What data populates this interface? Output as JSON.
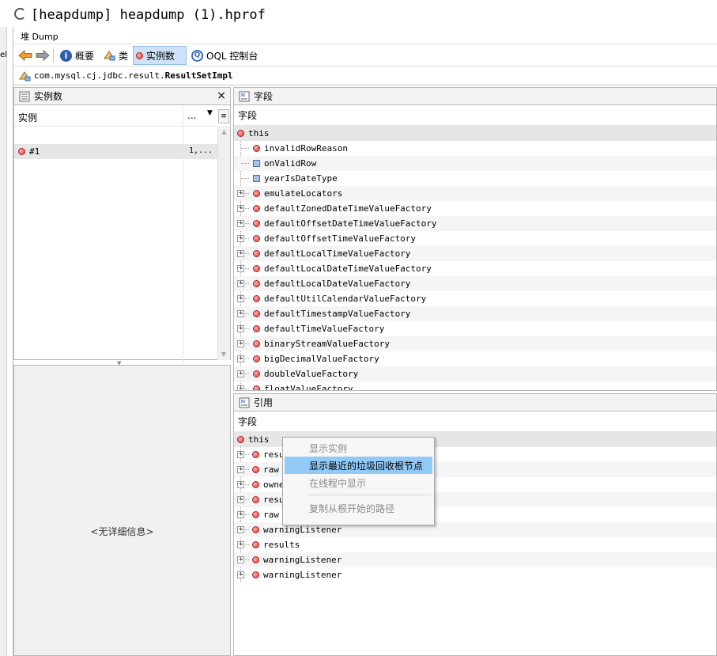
{
  "window": {
    "title": "[heapdump] heapdump (1).hprof",
    "left_edge_char": "el"
  },
  "dumpbar": {
    "label": "堆 Dump"
  },
  "toolbar": {
    "summary": "概要",
    "classes": "类",
    "instances": "实例数",
    "oql": "OQL 控制台",
    "oql_icon_text": "Q"
  },
  "class_path": {
    "prefix": "com.mysql.cj.jdbc.result.",
    "name": "ResultSetImpl"
  },
  "instances_pane": {
    "title": "实例数",
    "close_glyph": "×",
    "col_instance": "实例",
    "col_size": "...",
    "rows": [
      {
        "id": "#1",
        "size": "1,..."
      }
    ]
  },
  "detail_pane": {
    "empty_text": "<无详细信息>"
  },
  "fields_pane": {
    "title": "字段",
    "col": "字段",
    "root": "this",
    "items": [
      {
        "name": "invalidRowReason",
        "icon": "object",
        "expandable": false
      },
      {
        "name": "onValidRow",
        "icon": "primitive",
        "expandable": false
      },
      {
        "name": "yearIsDateType",
        "icon": "primitive",
        "expandable": false
      },
      {
        "name": "emulateLocators",
        "icon": "object",
        "expandable": true
      },
      {
        "name": "defaultZonedDateTimeValueFactory",
        "icon": "object",
        "expandable": true
      },
      {
        "name": "defaultOffsetDateTimeValueFactory",
        "icon": "object",
        "expandable": true
      },
      {
        "name": "defaultOffsetTimeValueFactory",
        "icon": "object",
        "expandable": true
      },
      {
        "name": "defaultLocalTimeValueFactory",
        "icon": "object",
        "expandable": true
      },
      {
        "name": "defaultLocalDateTimeValueFactory",
        "icon": "object",
        "expandable": true
      },
      {
        "name": "defaultLocalDateValueFactory",
        "icon": "object",
        "expandable": true
      },
      {
        "name": "defaultUtilCalendarValueFactory",
        "icon": "object",
        "expandable": true
      },
      {
        "name": "defaultTimestampValueFactory",
        "icon": "object",
        "expandable": true
      },
      {
        "name": "defaultTimeValueFactory",
        "icon": "object",
        "expandable": true
      },
      {
        "name": "binaryStreamValueFactory",
        "icon": "object",
        "expandable": true
      },
      {
        "name": "bigDecimalValueFactory",
        "icon": "object",
        "expandable": true
      },
      {
        "name": "doubleValueFactory",
        "icon": "object",
        "expandable": true
      },
      {
        "name": "floatValueFactory",
        "icon": "object",
        "expandable": true
      }
    ]
  },
  "refs_pane": {
    "title": "引用",
    "col": "字段",
    "root": "this",
    "items": [
      {
        "name": "resu"
      },
      {
        "name": "raw"
      },
      {
        "name": "owne"
      },
      {
        "name": "resu"
      },
      {
        "name": "raw"
      },
      {
        "name": "warningListener"
      },
      {
        "name": "results"
      },
      {
        "name": "warningListener"
      },
      {
        "name": "warningListener"
      }
    ]
  },
  "context_menu": {
    "items": [
      {
        "label": "显示实例",
        "enabled": false
      },
      {
        "label": "显示最近的垃圾回收根节点",
        "enabled": true,
        "highlighted": true
      },
      {
        "label": "在线程中显示",
        "enabled": false
      },
      {
        "label": "复制从根开始的路径",
        "enabled": false
      }
    ]
  }
}
